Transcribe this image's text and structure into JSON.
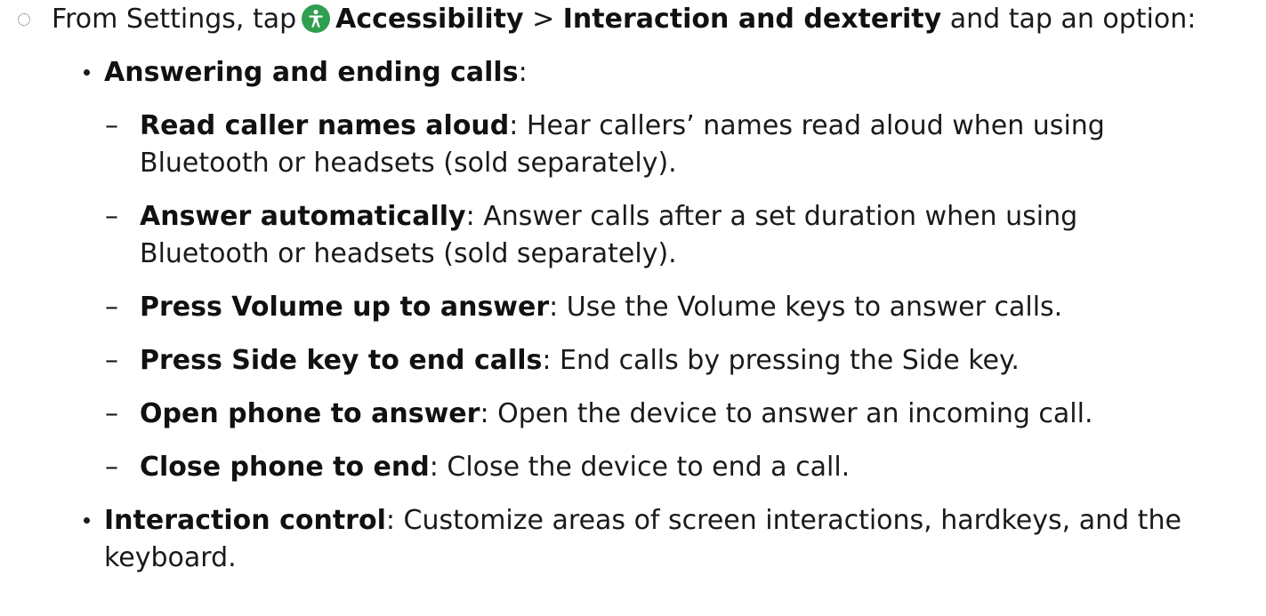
{
  "step": {
    "prefix": "From Settings, tap",
    "accessibility": "Accessibility",
    "sep": ">",
    "interaction": "Interaction and dexterity",
    "suffix": "and tap an option:"
  },
  "answering": {
    "title": "Answering and ending calls",
    "colon": ":",
    "items": [
      {
        "label": "Read caller names aloud",
        "text_line1": ": Hear callers’ names read aloud when using",
        "text_line2": "Bluetooth or headsets (sold separately)."
      },
      {
        "label": "Answer automatically",
        "text_line1": ": Answer calls after a set duration when using",
        "text_line2": "Bluetooth or headsets (sold separately)."
      },
      {
        "label": "Press Volume up to answer",
        "text_line1": ": Use the Volume keys to answer calls."
      },
      {
        "label": "Press Side key to end calls",
        "text_line1": ": End calls by pressing the Side key."
      },
      {
        "label": "Open phone to answer",
        "text_line1": ": Open the device to answer an incoming call."
      },
      {
        "label": "Close phone to end",
        "text_line1": ": Close the device to end a call."
      }
    ]
  },
  "interaction_control": {
    "label": "Interaction control",
    "text_line1": ": Customize areas of screen interactions, hardkeys, and the",
    "text_line2": "keyboard."
  },
  "dash": "–"
}
